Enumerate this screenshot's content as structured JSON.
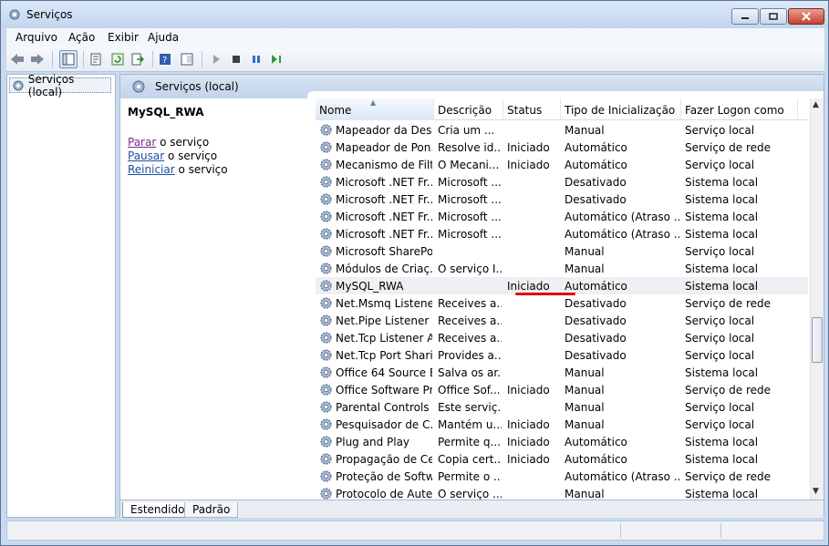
{
  "window": {
    "title": "Serviços"
  },
  "menu": [
    "Arquivo",
    "Ação",
    "Exibir",
    "Ajuda"
  ],
  "tree": {
    "item": "Serviços (local)"
  },
  "panel": {
    "header": "Serviços (local)"
  },
  "description": {
    "service_name": "MySQL_RWA",
    "actions": [
      {
        "link": "Parar",
        "rest": " o serviço"
      },
      {
        "link": "Pausar",
        "rest": " o serviço"
      },
      {
        "link": "Reiniciar",
        "rest": " o serviço"
      }
    ]
  },
  "columns": [
    "Nome",
    "Descrição",
    "Status",
    "Tipo de Inicialização",
    "Fazer Logon como"
  ],
  "rows": [
    {
      "name": "Mapeador da Des...",
      "desc": "Cria um ...",
      "status": "",
      "startup": "Manual",
      "logon": "Serviço local"
    },
    {
      "name": "Mapeador de Pon...",
      "desc": "Resolve id...",
      "status": "Iniciado",
      "startup": "Automático",
      "logon": "Serviço de rede"
    },
    {
      "name": "Mecanismo de Filt...",
      "desc": "O Mecani...",
      "status": "Iniciado",
      "startup": "Automático",
      "logon": "Serviço local"
    },
    {
      "name": "Microsoft .NET Fr...",
      "desc": "Microsoft ...",
      "status": "",
      "startup": "Desativado",
      "logon": "Sistema local"
    },
    {
      "name": "Microsoft .NET Fr...",
      "desc": "Microsoft ...",
      "status": "",
      "startup": "Desativado",
      "logon": "Sistema local"
    },
    {
      "name": "Microsoft .NET Fr...",
      "desc": "Microsoft ...",
      "status": "",
      "startup": "Automático (Atraso ...",
      "logon": "Sistema local"
    },
    {
      "name": "Microsoft .NET Fr...",
      "desc": "Microsoft ...",
      "status": "",
      "startup": "Automático (Atraso ...",
      "logon": "Sistema local"
    },
    {
      "name": "Microsoft SharePo...",
      "desc": "",
      "status": "",
      "startup": "Manual",
      "logon": "Serviço local"
    },
    {
      "name": "Módulos de Criaç...",
      "desc": "O serviço I...",
      "status": "",
      "startup": "Manual",
      "logon": "Sistema local"
    },
    {
      "name": "MySQL_RWA",
      "desc": "",
      "status": "Iniciado",
      "startup": "Automático",
      "logon": "Sistema local"
    },
    {
      "name": "Net.Msmq Listene...",
      "desc": "Receives a...",
      "status": "",
      "startup": "Desativado",
      "logon": "Serviço de rede"
    },
    {
      "name": "Net.Pipe Listener ...",
      "desc": "Receives a...",
      "status": "",
      "startup": "Desativado",
      "logon": "Serviço local"
    },
    {
      "name": "Net.Tcp Listener A...",
      "desc": "Receives a...",
      "status": "",
      "startup": "Desativado",
      "logon": "Serviço local"
    },
    {
      "name": "Net.Tcp Port Shari...",
      "desc": "Provides a...",
      "status": "",
      "startup": "Desativado",
      "logon": "Serviço local"
    },
    {
      "name": "Office 64 Source E...",
      "desc": "Salva os ar...",
      "status": "",
      "startup": "Manual",
      "logon": "Sistema local"
    },
    {
      "name": "Office Software Pr...",
      "desc": "Office Sof...",
      "status": "Iniciado",
      "startup": "Manual",
      "logon": "Serviço de rede"
    },
    {
      "name": "Parental Controls",
      "desc": "Este serviç...",
      "status": "",
      "startup": "Manual",
      "logon": "Serviço local"
    },
    {
      "name": "Pesquisador de C...",
      "desc": "Mantém u...",
      "status": "Iniciado",
      "startup": "Manual",
      "logon": "Serviço local"
    },
    {
      "name": "Plug and Play",
      "desc": "Permite q...",
      "status": "Iniciado",
      "startup": "Automático",
      "logon": "Sistema local"
    },
    {
      "name": "Propagação de Ce...",
      "desc": "Copia cert...",
      "status": "Iniciado",
      "startup": "Automático",
      "logon": "Sistema local"
    },
    {
      "name": "Proteção de Softw...",
      "desc": "Permite o ...",
      "status": "",
      "startup": "Automático (Atraso ...",
      "logon": "Serviço de rede"
    },
    {
      "name": "Protocolo de Aute...",
      "desc": "O serviço ...",
      "status": "",
      "startup": "Manual",
      "logon": "Sistema local"
    }
  ],
  "selected_index": 9,
  "tabs": [
    "Estendido",
    "Padrão"
  ],
  "highlight_color": "#e00000"
}
